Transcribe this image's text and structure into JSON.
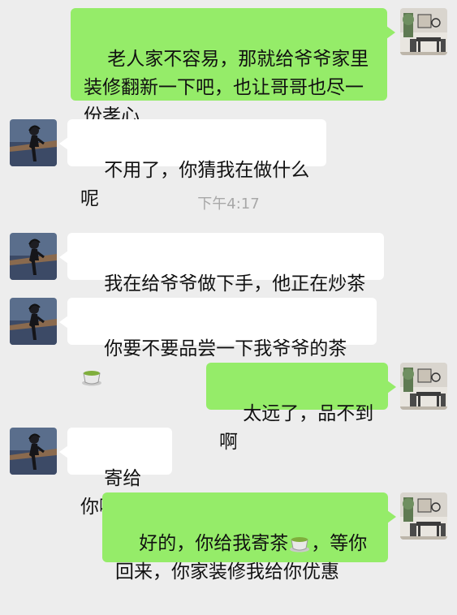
{
  "conversation": {
    "timestamp": "下午4:17",
    "messages": [
      {
        "sender": "me",
        "text": "老人家不容易，那就给爷爷家里装修翻新一下吧，也让哥哥也尽一份孝心"
      },
      {
        "sender": "contact",
        "text": "不用了，你猜我在做什么呢"
      },
      {
        "sender": "contact",
        "text": "我在给爷爷做下手，他正在炒茶呢"
      },
      {
        "sender": "contact",
        "text_before_emoji": "你要不要品尝一下我爷爷的茶",
        "emoji": "teacup-emoji"
      },
      {
        "sender": "me",
        "text": "太远了，品不到啊"
      },
      {
        "sender": "contact",
        "text": "寄给你啊"
      },
      {
        "sender": "me",
        "text_before_emoji": "好的，你给我寄茶",
        "emoji": "teacup-emoji",
        "text_after_emoji": "，等你回来，你家装修我给你优惠"
      }
    ]
  },
  "colors": {
    "background": "#ededed",
    "my_bubble": "#95ec69",
    "contact_bubble": "#ffffff",
    "timestamp_text": "#a8a8a8"
  },
  "icons": {
    "my_avatar": "interior-room-avatar",
    "contact_avatar": "woman-silhouette-avatar"
  }
}
